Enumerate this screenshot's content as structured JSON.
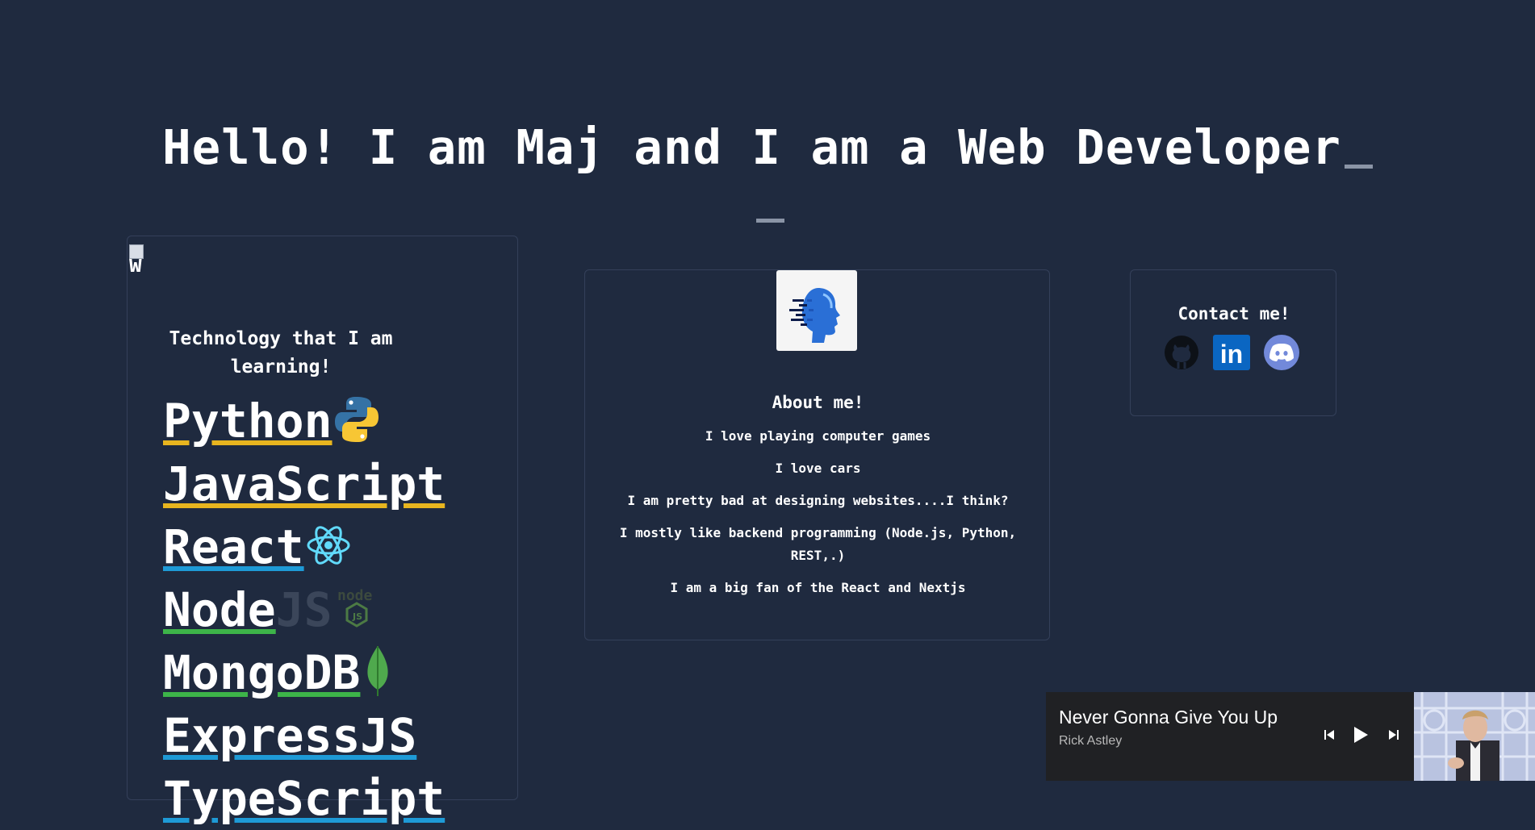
{
  "hero": {
    "heading": "Hello! I am Maj and I am a Web Developer"
  },
  "tech": {
    "broken_image_alt": "W",
    "title": "Technology that I am learning!",
    "items": [
      {
        "name": "Python",
        "icon": "python-icon"
      },
      {
        "name": "JavaScript",
        "icon": "none"
      },
      {
        "name": "React",
        "icon": "react-icon"
      },
      {
        "name": "Node",
        "suffix": "JS",
        "icon": "nodejs-icon"
      },
      {
        "name": "MongoDB",
        "icon": "mongodb-leaf-icon"
      },
      {
        "name": "ExpressJS",
        "icon": "none"
      },
      {
        "name": "TypeScript",
        "icon": "none"
      }
    ]
  },
  "about": {
    "avatar_icon": "digital-head-icon",
    "title": "About me!",
    "lines": [
      "I love playing computer games",
      "I love cars",
      "I am pretty bad at designing websites....I think?",
      "I mostly like backend programming (Node.js, Python, REST,.)",
      "I am a big fan of the React and Nextjs"
    ]
  },
  "contact": {
    "title": "Contact me!",
    "icons": [
      "github-icon",
      "linkedin-icon",
      "discord-icon"
    ],
    "linkedin_text": "in"
  },
  "player": {
    "title": "Never Gonna Give You Up",
    "artist": "Rick Astley",
    "controls": [
      "previous-icon",
      "play-icon",
      "next-icon"
    ]
  },
  "colors": {
    "background": "#1f2a3f",
    "card_border": "#34405a",
    "python_blue": "#1e9ad6",
    "js_yellow": "#e8b51f",
    "node_green": "#3db449",
    "linkedin_blue": "#0a66c2",
    "discord_purple": "#7289da"
  }
}
